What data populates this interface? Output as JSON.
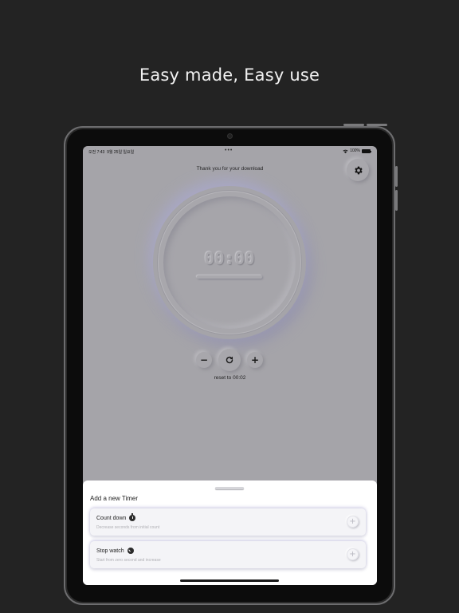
{
  "headline": "Easy made, Easy use",
  "status_bar": {
    "time": "오전 7:43",
    "date": "9월 25일 일요일",
    "dots": "•••",
    "battery": "100%"
  },
  "main": {
    "thanks_text": "Thank you for your download",
    "timer_display": "00:00",
    "controls": {
      "minus": "−",
      "reset": "↻",
      "plus": "+"
    },
    "reset_label": "reset to 00:02"
  },
  "sheet": {
    "title": "Add a new Timer",
    "options": [
      {
        "title": "Count down",
        "subtitle": "Decrease seconds from initial count",
        "icon": "stopwatch-icon",
        "action": "+"
      },
      {
        "title": "Stop watch",
        "subtitle": "Start from zero second and increase",
        "icon": "clock-icon",
        "action": "+"
      }
    ]
  },
  "colors": {
    "background": "#232323",
    "screen": "#a5a4a9",
    "sheet": "#ffffff",
    "glow": "#a9a8c6"
  }
}
